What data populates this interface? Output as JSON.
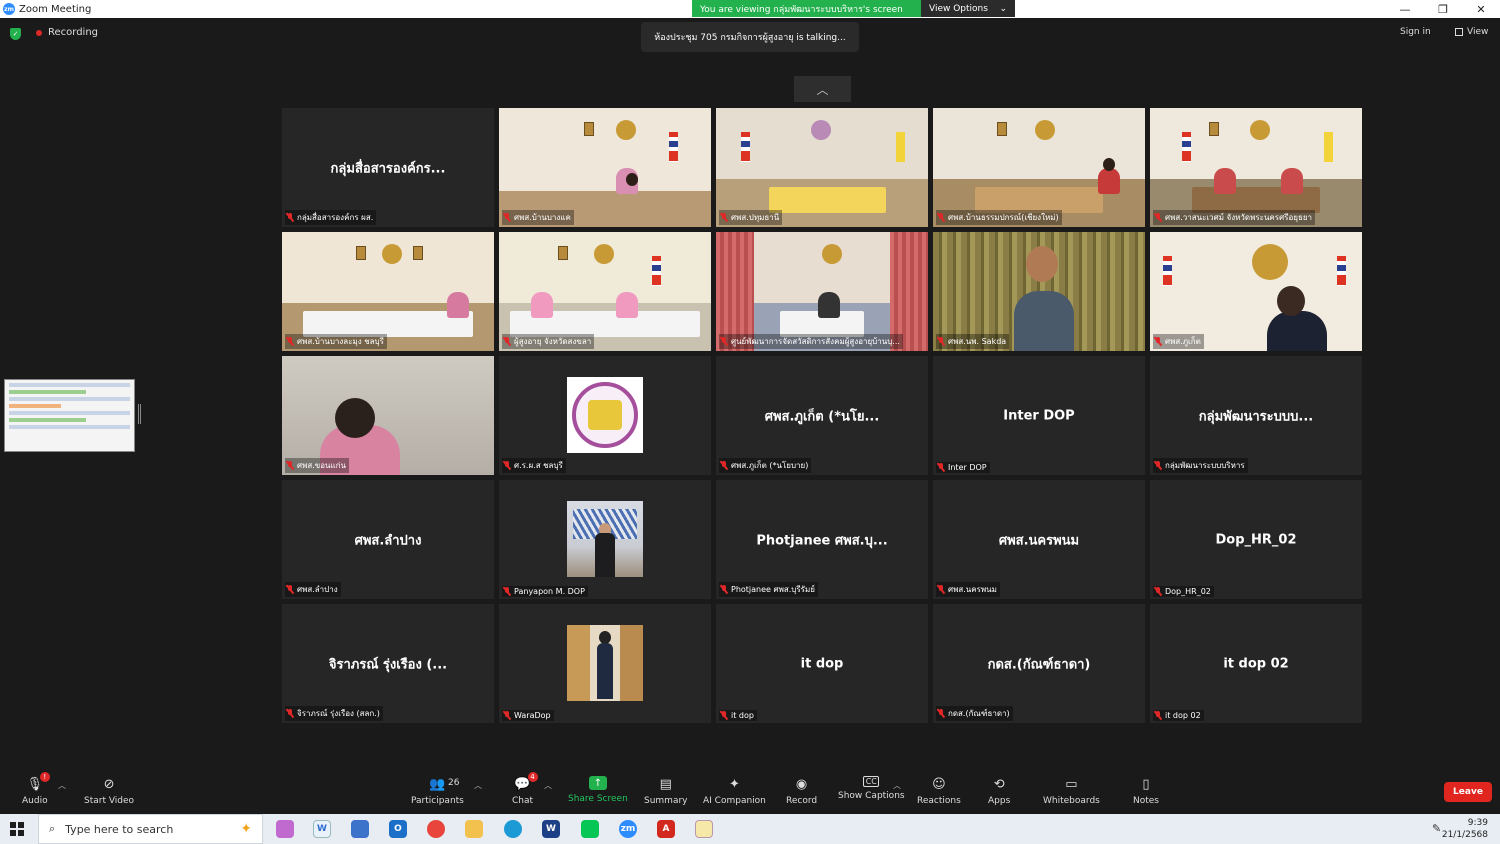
{
  "window": {
    "title": "Zoom Meeting",
    "viewing_banner": "You are viewing กลุ่มพัฒนาระบบบริหาร's screen",
    "view_options": "View Options",
    "controls": [
      "—",
      "❐",
      "✕"
    ]
  },
  "status": {
    "recording": "Recording",
    "talking": "ห้องประชุม 705 กรมกิจการผู้สูงอายุ is talking...",
    "sign_in": "Sign in",
    "view": "View"
  },
  "tiles": [
    {
      "type": "name",
      "center": "กลุ่มสื่อสารองค์กร...",
      "label": "กลุ่มสื่อสารองค์กร ผส."
    },
    {
      "type": "video",
      "scene": "office-flag",
      "label": "ศพส.บ้านบางแค"
    },
    {
      "type": "video",
      "scene": "meeting-yellow",
      "label": "ศพส.ปทุมธานี"
    },
    {
      "type": "video",
      "scene": "conference",
      "label": "ศพส.บ้านธรรมปกรณ์(เชียงใหม่)"
    },
    {
      "type": "video",
      "scene": "meeting-flags",
      "label": "ศพส.วาสนะเวศม์ จังหวัดพระนครศรีอยุธยา"
    },
    {
      "type": "video",
      "scene": "room-wide",
      "label": "ศพส.บ้านบางละมุง ชลบุรี"
    },
    {
      "type": "video",
      "scene": "desk-pink",
      "label": "ผู้สูงอายุ จังหวัดสงขลา"
    },
    {
      "type": "video",
      "scene": "room-curtain",
      "label": "ศูนย์พัฒนาการจัดสวัสดิการสังคมผู้สูงอายุบ้านบุ..."
    },
    {
      "type": "video",
      "scene": "bamboo-man",
      "label": "ศพส.นพ. Sakda"
    },
    {
      "type": "video",
      "scene": "woman-front",
      "label": "ศพส.ภูเก็ต"
    },
    {
      "type": "video",
      "scene": "woman-window",
      "label": "ศพส.ขอนแก่น"
    },
    {
      "type": "avatar",
      "avatar": "seal",
      "label": "ศ.ร.ผ.ส ชลบุรี"
    },
    {
      "type": "name",
      "center": "ศพส.ภูเก็ต (*นโย...",
      "label": "ศพส.ภูเก็ต (*นโยบาย)"
    },
    {
      "type": "name",
      "center": "Inter DOP",
      "label": "Inter DOP"
    },
    {
      "type": "name",
      "center": "กลุ่มพัฒนาระบบบ...",
      "label": "กลุ่มพัฒนาระบบบริหาร"
    },
    {
      "type": "name",
      "center": "ศพส.ลำปาง",
      "label": "ศพส.ลำปาง"
    },
    {
      "type": "avatar",
      "avatar": "panyapon",
      "label": "Panyapon M. DOP"
    },
    {
      "type": "name",
      "center": "Photjanee ศพส.บุ...",
      "label": "Photjanee ศพส.บุรีรัมย์"
    },
    {
      "type": "name",
      "center": "ศพส.นครพนม",
      "label": "ศพส.นครพนม"
    },
    {
      "type": "name",
      "center": "Dop_HR_02",
      "label": "Dop_HR_02"
    },
    {
      "type": "name",
      "center": "จิราภรณ์ รุ่งเรือง (...",
      "label": "จิราภรณ์ รุ่งเรือง (สลก.)"
    },
    {
      "type": "avatar",
      "avatar": "wara",
      "label": "WaraDop"
    },
    {
      "type": "name",
      "center": "it dop",
      "label": "it dop"
    },
    {
      "type": "name",
      "center": "กดส.(กัณฑ์ธาดา)",
      "label": "กดส.(กัณฑ์ธาดา)"
    },
    {
      "type": "name",
      "center": "it dop 02",
      "label": "it dop 02"
    }
  ],
  "toolbar": {
    "audio": "Audio",
    "audio_badge": "!",
    "start_video": "Start Video",
    "participants": "Participants",
    "participants_count": "26",
    "chat": "Chat",
    "chat_badge": "4",
    "share_screen": "Share Screen",
    "summary": "Summary",
    "ai_companion": "AI Companion",
    "record": "Record",
    "show_captions": "Show Captions",
    "reactions": "Reactions",
    "apps": "Apps",
    "whiteboards": "Whiteboards",
    "notes": "Notes",
    "leave": "Leave"
  },
  "taskbar": {
    "search_placeholder": "Type here to search",
    "time": "9:39",
    "date": "21/1/2568"
  },
  "colors": {
    "accent_green": "#23b14d",
    "leave_red": "#e0261e",
    "zoom_blue": "#2d8cff"
  }
}
